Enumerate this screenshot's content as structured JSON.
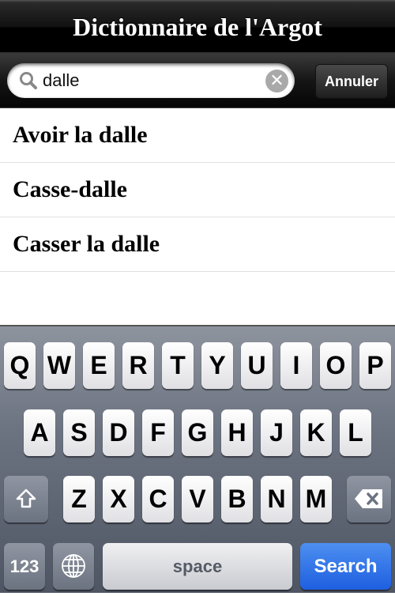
{
  "nav": {
    "title": "Dictionnaire de l'Argot"
  },
  "search": {
    "value": "dalle",
    "placeholder": "",
    "cancel_label": "Annuler"
  },
  "results": [
    "Avoir la dalle",
    "Casse-dalle",
    "Casser la dalle"
  ],
  "keyboard": {
    "rows": [
      [
        "Q",
        "W",
        "E",
        "R",
        "T",
        "Y",
        "U",
        "I",
        "O",
        "P"
      ],
      [
        "A",
        "S",
        "D",
        "F",
        "G",
        "H",
        "J",
        "K",
        "L"
      ],
      [
        "Z",
        "X",
        "C",
        "V",
        "B",
        "N",
        "M"
      ]
    ],
    "numbers_label": "123",
    "space_label": "space",
    "search_label": "Search",
    "search_color": "#2f72e8"
  }
}
